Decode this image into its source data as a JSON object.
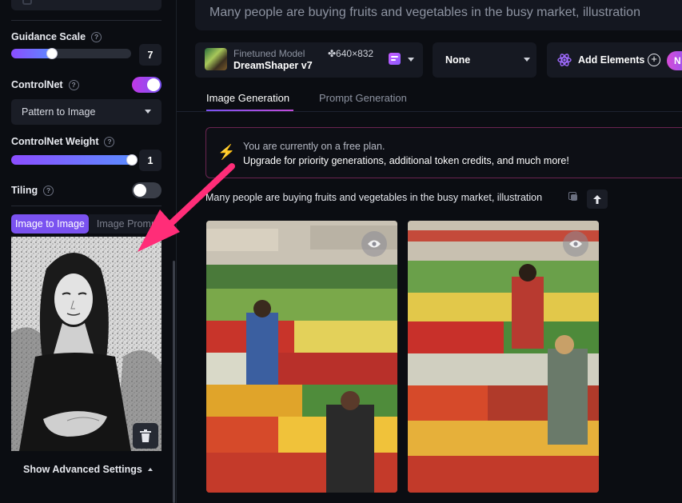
{
  "sidebar": {
    "guidance_label": "Guidance Scale",
    "guidance_value": "7",
    "guidance_fraction": 0.32,
    "controlnet_label": "ControlNet",
    "controlnet_on": true,
    "controlnet_mode": "Pattern to Image",
    "weight_label": "ControlNet Weight",
    "weight_value": "1",
    "weight_fraction": 1.0,
    "tiling_label": "Tiling",
    "tiling_on": false,
    "tab_image_to_image": "Image to Image",
    "tab_image_prompt": "Image Prompt",
    "advanced_label": "Show Advanced Settings"
  },
  "main": {
    "prompt_text": "Many people are buying fruits and vegetables in the busy market, illustration",
    "model_sublabel": "Finetuned Model",
    "model_name": "DreamShaper v7",
    "model_dims": "✤640×832",
    "style_select": "None",
    "elements_label": "Add Elements",
    "elements_pill": "N",
    "tabs": [
      {
        "label": "Image Generation",
        "active": true
      },
      {
        "label": "Prompt Generation",
        "active": false
      }
    ],
    "banner_line1": "You are currently on a free plan.",
    "banner_line2": "Upgrade for priority generations, additional token credits, and much more!",
    "generation_prompt": "Many people are buying fruits and vegetables in the busy market, illustration"
  },
  "colors": {
    "accent_purple": "#7a52f0",
    "accent_pink": "#c24cd9",
    "annotation_arrow": "#ff2d78",
    "bolt_yellow": "#f5c542"
  }
}
